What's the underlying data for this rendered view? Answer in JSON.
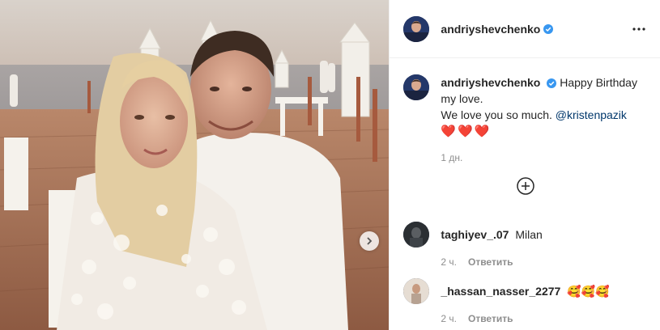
{
  "post": {
    "author": "andriyshevchenko",
    "verified": true
  },
  "caption": {
    "username": "andriyshevchenko",
    "line1": "Happy Birthday",
    "line2": "my love.",
    "line3_prefix": "We love you so much. ",
    "mention": "@kristenpazik",
    "hearts": "❤️❤️❤️",
    "time": "1 дн."
  },
  "comments": [
    {
      "username": "taghiyev_.07",
      "text": "Milan",
      "time": "2 ч.",
      "reply_label": "Ответить"
    },
    {
      "username": "_hassan_nasser_2277",
      "text": "🥰🥰🥰",
      "time": "2 ч.",
      "reply_label": "Ответить"
    }
  ],
  "colors": {
    "verified": "#3897f0",
    "mention": "#00376b",
    "heart": "#ed4956"
  },
  "icons": {
    "more": "more-horizontal-icon",
    "load_more": "plus-circle-icon",
    "next": "chevron-right-icon",
    "verified": "verified-badge-icon"
  }
}
